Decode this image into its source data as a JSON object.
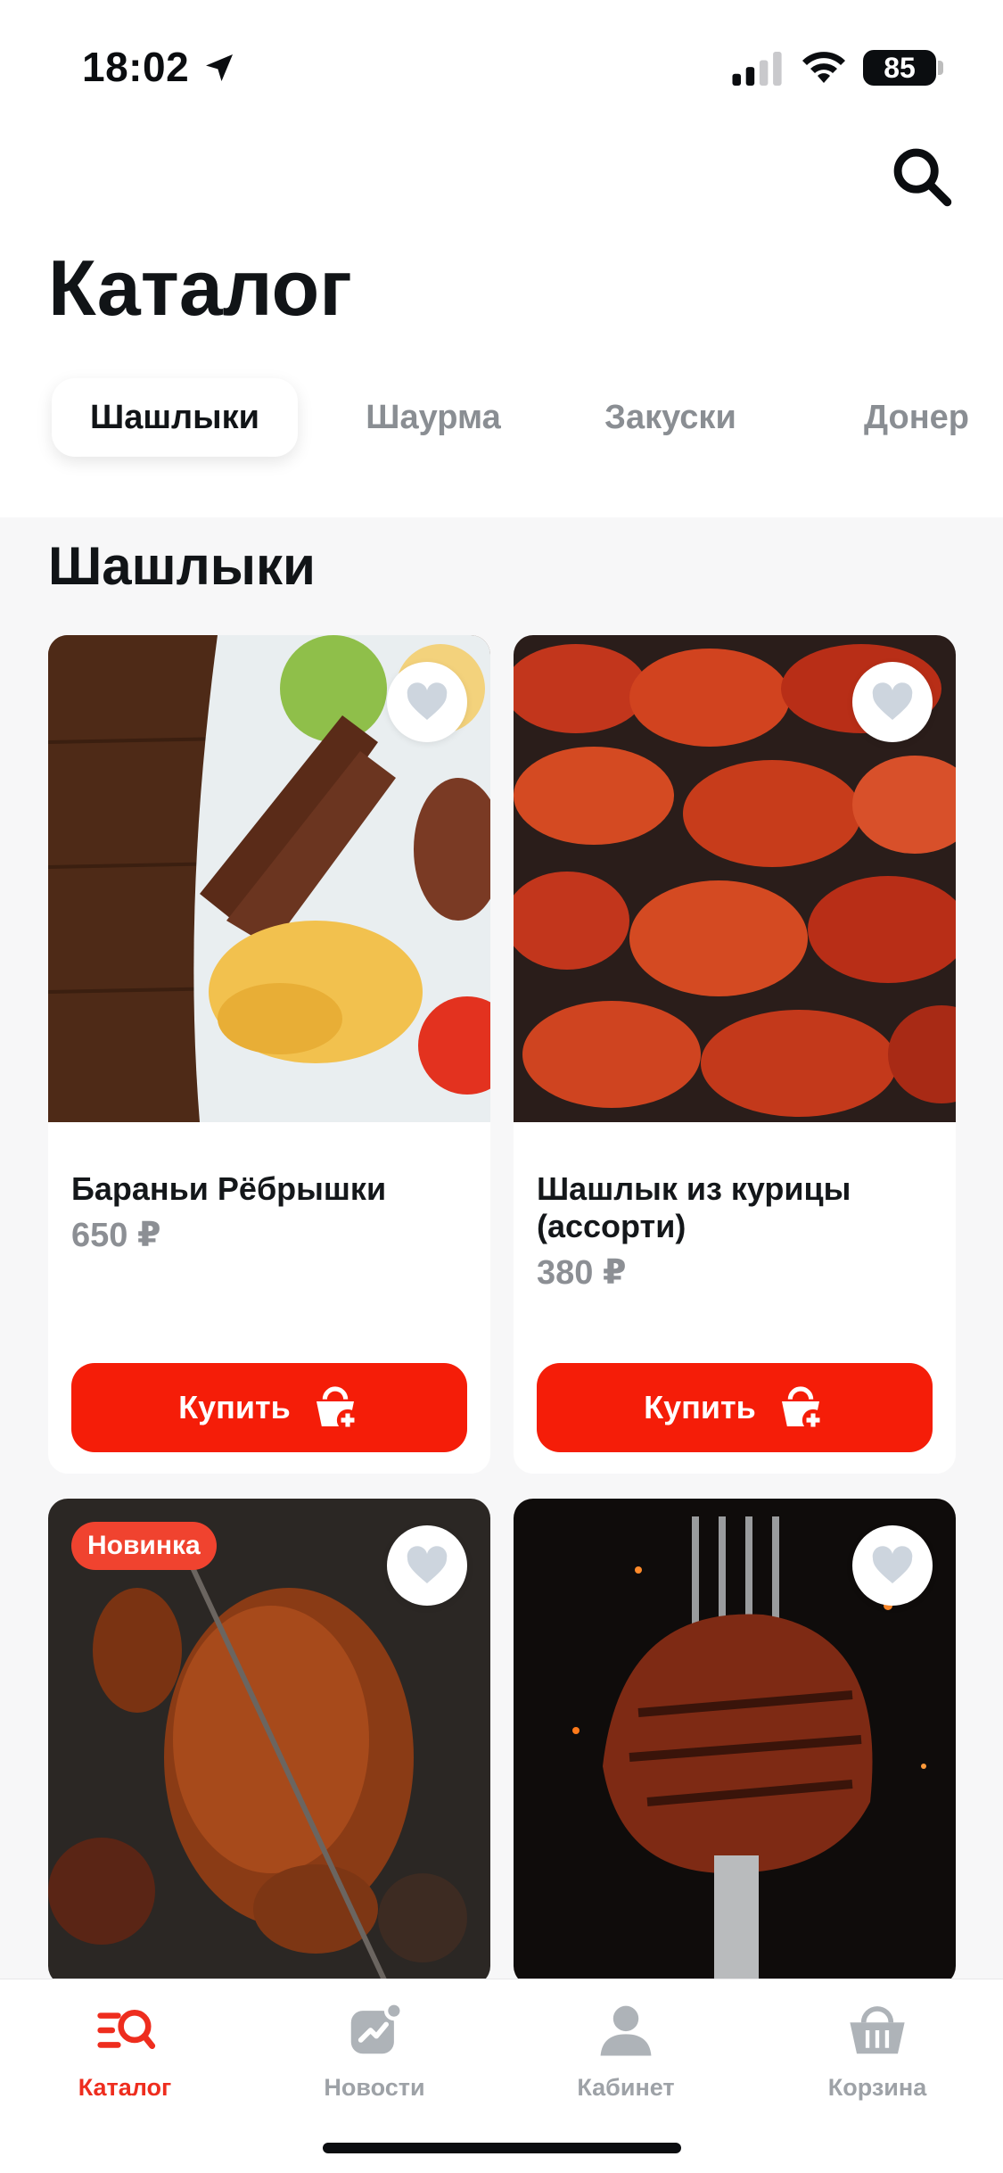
{
  "status_bar": {
    "time": "18:02",
    "battery": "85"
  },
  "header": {
    "title": "Каталог",
    "search_icon": "search-icon"
  },
  "tabs": [
    {
      "label": "Шашлыки",
      "active": true
    },
    {
      "label": "Шаурма",
      "active": false
    },
    {
      "label": "Закуски",
      "active": false
    },
    {
      "label": "Донер",
      "active": false
    }
  ],
  "section": {
    "title": "Шашлыки"
  },
  "products": [
    {
      "name": "Бараньи Рёбрышки",
      "price": "650 ₽",
      "buy_label": "Купить",
      "badge": ""
    },
    {
      "name": "Шашлык из курицы (ассорти)",
      "price": "380 ₽",
      "buy_label": "Купить",
      "badge": ""
    },
    {
      "name": "",
      "price": "",
      "buy_label": "",
      "badge": "Новинка"
    },
    {
      "name": "",
      "price": "",
      "buy_label": "",
      "badge": ""
    }
  ],
  "bottom_nav": [
    {
      "label": "Каталог",
      "icon": "catalog-icon",
      "active": true
    },
    {
      "label": "Новости",
      "icon": "news-icon",
      "active": false
    },
    {
      "label": "Кабинет",
      "icon": "profile-icon",
      "active": false
    },
    {
      "label": "Корзина",
      "icon": "basket-icon",
      "active": false
    }
  ],
  "colors": {
    "accent": "#f51d08",
    "badge": "#f0432f",
    "inactive": "#9ea2a7"
  }
}
